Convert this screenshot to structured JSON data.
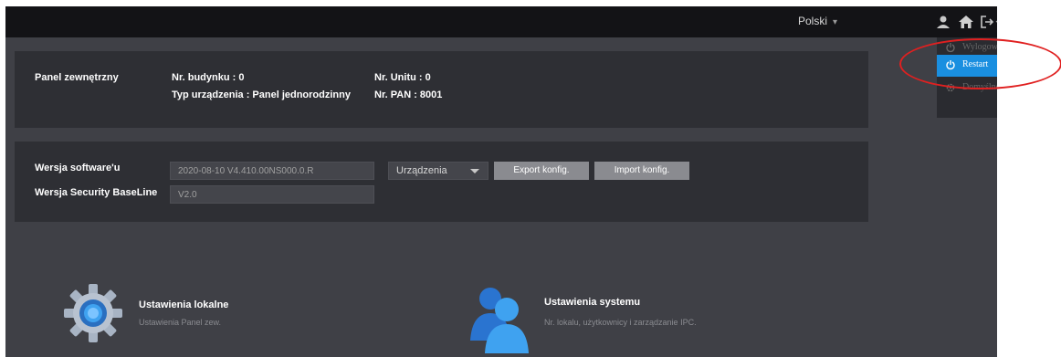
{
  "topbar": {
    "language": "Polski",
    "icons": [
      "user-icon",
      "home-icon",
      "logout-icon"
    ]
  },
  "menu": {
    "items": [
      {
        "label": "Wylogowanie",
        "icon": "power-icon"
      },
      {
        "label": "Restart",
        "icon": "power-icon"
      },
      {
        "label": "Domyślne",
        "icon": "gear-icon"
      }
    ]
  },
  "device": {
    "type_label": "Panel zewnętrzny",
    "building": "Nr. budynku : 0",
    "unit": "Nr. Unitu : 0",
    "device_type": "Typ urządzenia : Panel jednorodzinny",
    "pan": "Nr. PAN : 8001"
  },
  "version": {
    "software_label": "Wersja software'u",
    "software_value": "2020-08-10 V4.410.00NS000.0.R",
    "baseline_label": "Wersja Security BaseLine",
    "baseline_value": "V2.0",
    "select_value": "Urządzenia",
    "export_label": "Export konfig.",
    "import_label": "Import konfig."
  },
  "tiles": [
    {
      "title": "Ustawienia lokalne",
      "desc": "Ustawienia Panel zew.",
      "icon": "gear-icon"
    },
    {
      "title": "Ustawienia systemu",
      "desc": "Nr. lokalu, użytkownicy i zarządzanie IPC.",
      "icon": "users-icon"
    }
  ],
  "colors": {
    "background": "#3f4046",
    "panel": "#2e2f34",
    "topbar": "#131316",
    "accent": "#1a8fe0",
    "annotation": "#e02020"
  }
}
